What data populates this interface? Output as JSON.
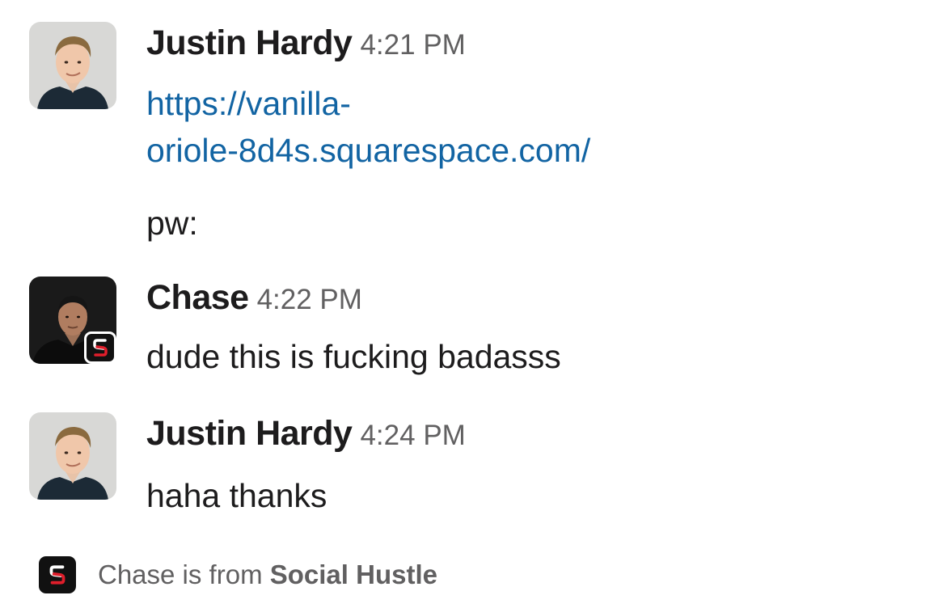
{
  "messages": [
    {
      "sender": "Justin Hardy",
      "time": "4:21 PM",
      "link_line1": "https://vanilla-",
      "link_line2": "oriole-8d4s.squarespace.com/",
      "text": "pw:"
    },
    {
      "sender": "Chase",
      "time": "4:22 PM",
      "text": "dude this is fucking badasss"
    },
    {
      "sender": "Justin Hardy",
      "time": "4:24 PM",
      "text": "haha thanks"
    }
  ],
  "footer": {
    "prefix": "Chase is from ",
    "org": "Social Hustle"
  },
  "colors": {
    "link": "#1264a3",
    "muted": "#616061",
    "text": "#1d1c1d",
    "logo_bg": "#111111",
    "logo_accent": "#e01e2b"
  }
}
